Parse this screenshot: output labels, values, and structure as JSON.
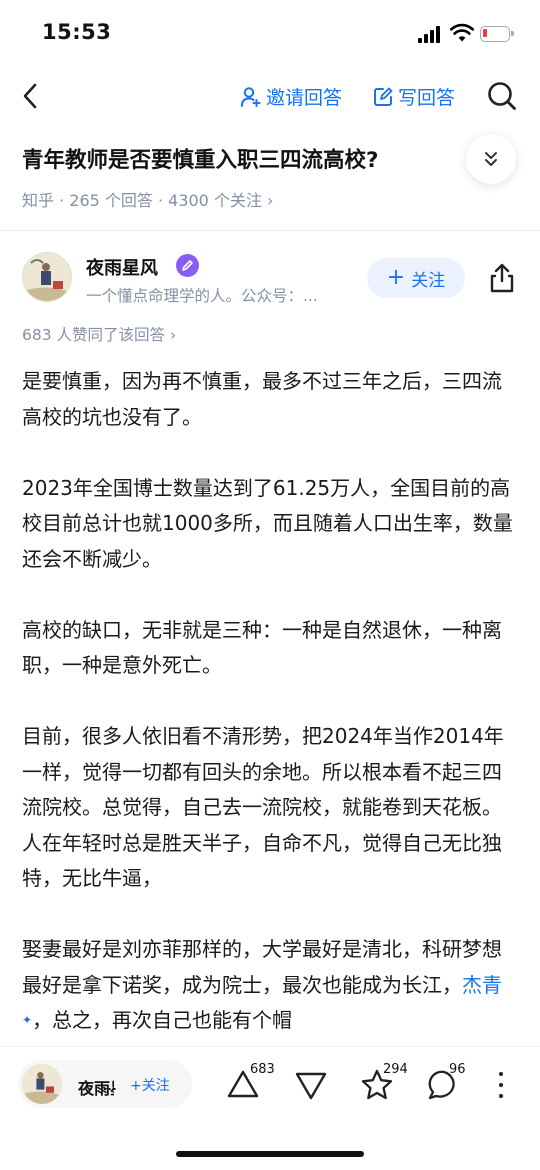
{
  "status_bar": {
    "time": "15:53"
  },
  "nav": {
    "invite_label": "邀请回答",
    "write_label": "写回答"
  },
  "question": {
    "title": "青年教师是否要慎重入职三四流高校?",
    "meta": "知乎 · 265 个回答 · 4300 个关注 ›"
  },
  "author": {
    "name": "夜雨星风",
    "bio": "一个懂点命理学的人。公众号：...",
    "follow_label": "关注"
  },
  "upvote_summary": "683 人赞同了该回答 ›",
  "answer": {
    "p1": "是要慎重，因为再不慎重，最多不过三年之后，三四流高校的坑也没有了。",
    "p2": "2023年全国博士数量达到了61.25万人，全国目前的高校目前总计也就1000多所，而且随着人口出生率，数量还会不断减少。",
    "p3": "高校的缺口，无非就是三种：一种是自然退休，一种离职，一种是意外死亡。",
    "p4": "目前，很多人依旧看不清形势，把2024年当作2014年一样，觉得一切都有回头的余地。所以根本看不起三四流院校。总觉得，自己去一流院校，就能卷到天花板。人在年轻时总是胜天半子，自命不凡，觉得自己无比独特，无比牛逼，",
    "p5_before": "娶妻最好是刘亦菲那样的，大学最好是清北，科研梦想最好是拿下诺奖，成为院士，最次也能成为长江，",
    "p5_keyword": "杰青",
    "p5_after": "，总之，再次自己也能有个帽"
  },
  "bottom_bar": {
    "author_name": "夜雨星风",
    "ellipsis": "...",
    "follow_label": "+关注",
    "upvote_count": "683",
    "favorite_count": "294",
    "comment_count": "96"
  },
  "colors": {
    "accent": "#1772f6",
    "muted": "#8590a6",
    "badge": "#8a5cf6"
  }
}
